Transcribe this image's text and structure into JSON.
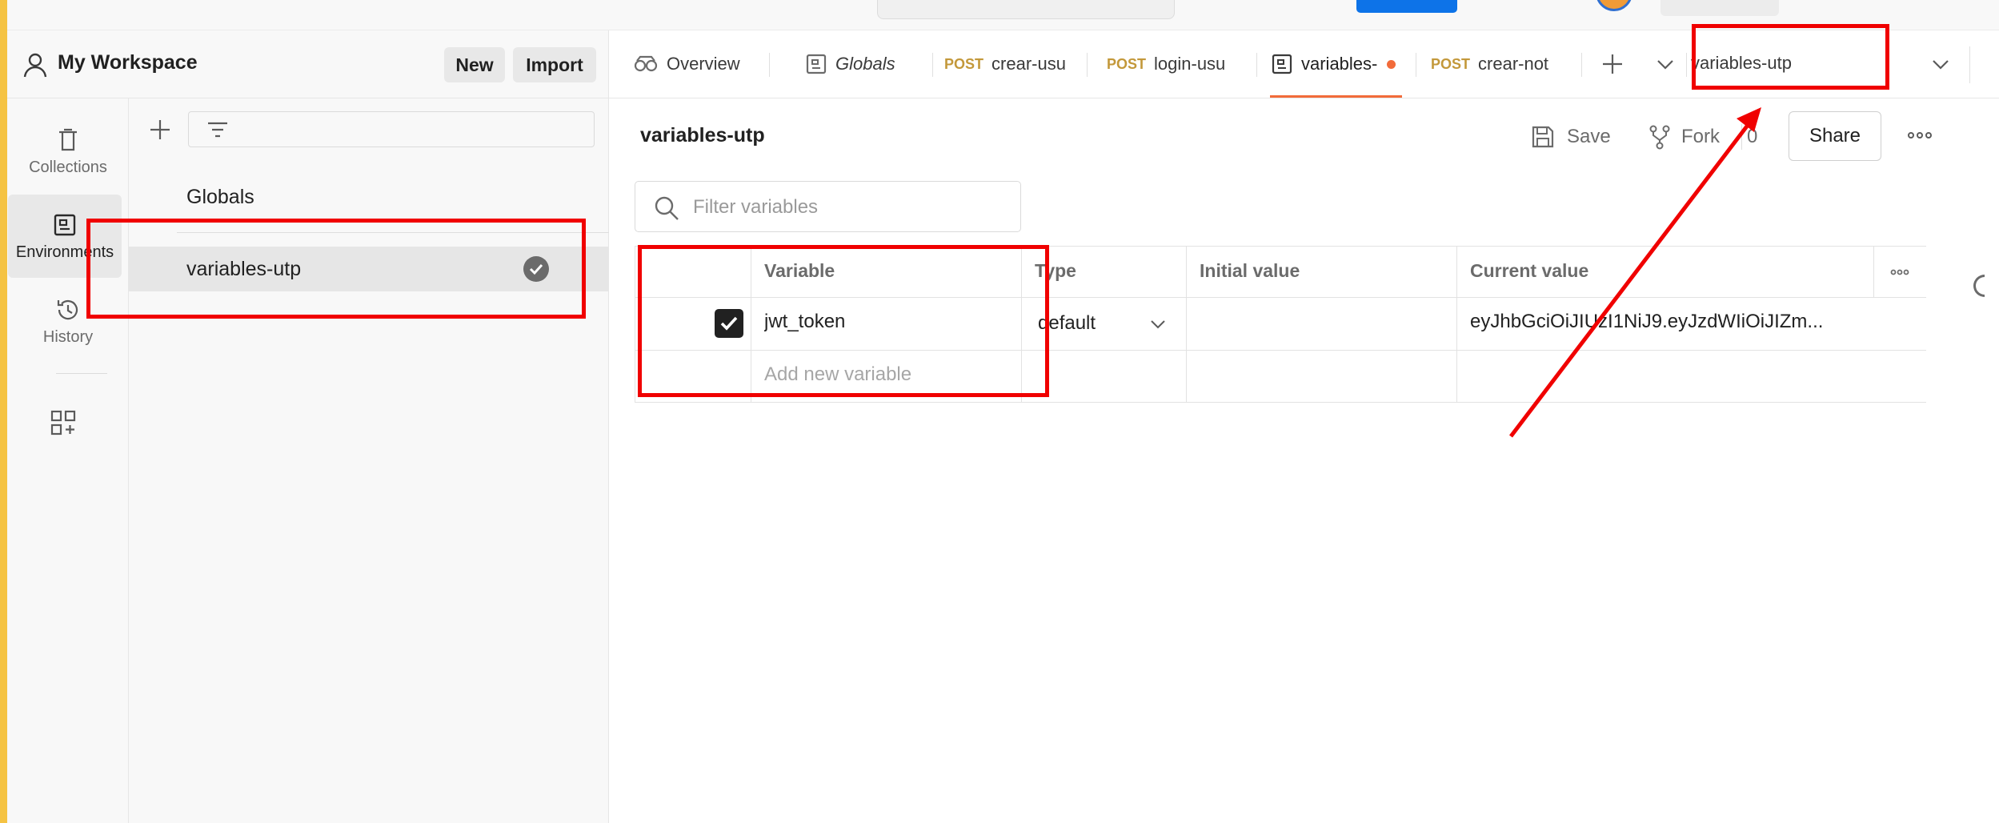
{
  "workspace": {
    "title": "My Workspace",
    "new_label": "New",
    "import_label": "Import"
  },
  "rail": {
    "items": [
      {
        "label": "Collections",
        "icon": "trash-can-icon"
      },
      {
        "label": "Environments",
        "icon": "environment-icon"
      },
      {
        "label": "History",
        "icon": "history-icon"
      }
    ],
    "apps_icon": "add-apps-icon"
  },
  "environments": {
    "items": [
      {
        "label": "Globals"
      },
      {
        "label": "variables-utp"
      }
    ]
  },
  "tabs": [
    {
      "label": "Overview",
      "icon": "overview-icon"
    },
    {
      "label": "Globals",
      "icon": "globals-icon"
    },
    {
      "method": "POST",
      "label": "crear-usu"
    },
    {
      "method": "POST",
      "label": "login-usu"
    },
    {
      "label": "variables-",
      "icon": "environment-icon"
    },
    {
      "method": "POST",
      "label": "crear-not"
    }
  ],
  "active_environment": "variables-utp",
  "main": {
    "title": "variables-utp",
    "save_label": "Save",
    "fork_label": "Fork",
    "fork_count": "0",
    "share_label": "Share",
    "filter_placeholder": "Filter variables"
  },
  "table": {
    "headers": [
      "Variable",
      "Type",
      "Initial value",
      "Current value"
    ],
    "rows": [
      {
        "enabled": true,
        "variable": "jwt_token",
        "type": "default",
        "initial": "",
        "current": "eyJhbGciOiJIUzI1NiJ9.eyJzdWIiOiJIZm..."
      }
    ],
    "add_placeholder": "Add new variable"
  },
  "colors": {
    "accent_stripe": "#f5c343",
    "annotation_red": "#f00000",
    "active_tab": "#f26b3a",
    "method_post": "#c3983a"
  }
}
